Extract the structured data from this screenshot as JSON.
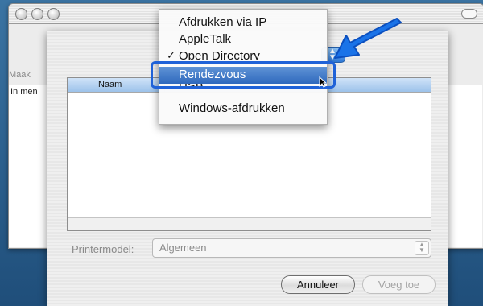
{
  "window": {
    "toolbar_label": "Maak",
    "list_header": "In men"
  },
  "sheet": {
    "table_header_name": "Naam",
    "printer_model_label": "Printermodel:",
    "printer_model_value": "Algemeen",
    "cancel_label": "Annuleer",
    "add_label": "Voeg toe"
  },
  "connection_menu": {
    "items": [
      {
        "label": "Afdrukken via IP",
        "checked": false,
        "selected": false
      },
      {
        "label": "AppleTalk",
        "checked": false,
        "selected": false
      },
      {
        "label": "Open Directory",
        "checked": true,
        "selected": false
      },
      {
        "label": "Rendezvous",
        "checked": false,
        "selected": true
      },
      {
        "label": "USB",
        "checked": false,
        "selected": false
      },
      {
        "label": "Windows-afdrukken",
        "checked": false,
        "selected": false
      }
    ],
    "check_glyph": "✓"
  },
  "colors": {
    "accent": "#2f69bd",
    "callout_arrow": "#1a73e8",
    "highlight_frame": "#1f62d8"
  }
}
